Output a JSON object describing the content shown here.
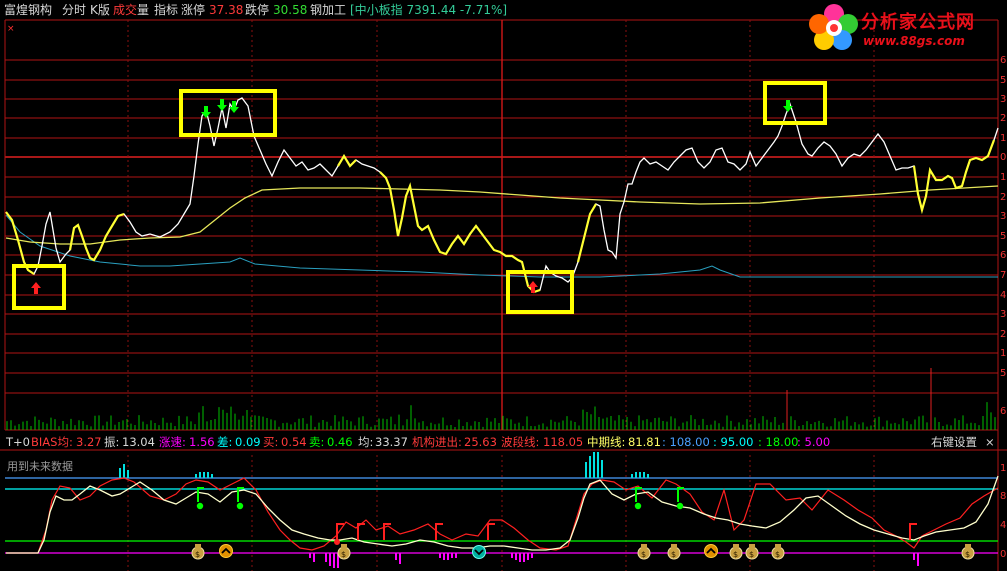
{
  "header": {
    "stock_name": "富煌钢构",
    "tab_timeshare": "分时",
    "tab_kline": "K版",
    "volume_prefix": "成交",
    "volume_suffix": "量",
    "indicator_label": "指标",
    "limit_up_label": "涨停",
    "limit_up_value": "37.38",
    "limit_down_label": "跌停",
    "limit_down_value": "30.58",
    "sector": "钢加工",
    "index_info": "[中小板指 7391.44 -7.71%]"
  },
  "logo": {
    "title": "分析家公式网",
    "url": "www.88gs.com"
  },
  "close_marker": "×",
  "right_axis_digits": [
    "6",
    "5",
    "3",
    "2",
    "1",
    "0",
    "1",
    "2",
    "3",
    "5",
    "6",
    "7",
    "4",
    "3",
    "2",
    "1",
    "5",
    "6"
  ],
  "indicator_bar": {
    "mode": "T+0",
    "bias_label": "BIAS均:",
    "bias_value": "3.27",
    "amp_label": "振:",
    "amp_value": "13.04",
    "speed_label": "涨速:",
    "speed_value": "1.56",
    "diff_label": "差:",
    "diff_value": "0.09",
    "buy_label": "买:",
    "buy_value": "0.54",
    "sell_label": "卖:",
    "sell_value": "0.46",
    "avg_label": "均:",
    "avg_value": "33.37",
    "inst_label": "机构进出:",
    "inst_value": "25.63",
    "wave_label": "波段线:",
    "wave_value": "118.05",
    "mid_label": "中期线:",
    "mid_value": "81.81",
    "lvl1": ": 108.00",
    "lvl2": ": 95.00",
    "lvl3": ": 18.00",
    "lvl4": ": 5.00",
    "settings_button": "右键设置",
    "close_button": "×"
  },
  "future_data_label": "用到未来数据",
  "lower_axis_digits": [
    "1",
    "8",
    "4",
    "0"
  ],
  "colors": {
    "grid_red": "#b01414",
    "price_line": "#ffffff",
    "price_highlight": "#ffff33",
    "avg_line": "#e6e65a",
    "blue_line": "#2aa0c0",
    "highlight_box": "#ffff00",
    "volume_bar": "#00c000",
    "ind_red": "#ff2020",
    "ind_green": "#00ff00",
    "ind_cyan": "#00ffff",
    "ind_magenta": "#ff00ff",
    "ind_blue": "#4aa0ff"
  },
  "icons": {
    "down_arrow": "green-down-arrow-icon",
    "up_arrow": "red-up-arrow-icon",
    "money_bag": "money-bag-icon",
    "orange_up": "orange-chevron-up-icon",
    "teal_down": "teal-chevron-down-icon",
    "flower_logo": "flower-logo-icon"
  }
}
